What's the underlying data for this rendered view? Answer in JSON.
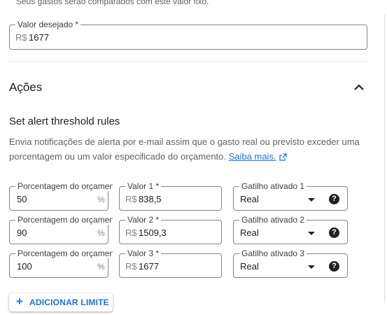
{
  "top_caption": "Seus gastos serão comparados com este valor fixo.",
  "desired_value": {
    "label": "Valor desejado *",
    "prefix": "R$",
    "value": "1677"
  },
  "actions_section": {
    "title": "Ações"
  },
  "rules": {
    "title": "Set alert threshold rules",
    "description": "Envia notificações de alerta por e-mail assim que o gasto real ou previsto exceder uma porcentagem ou um valor especificado do orçamento.",
    "learn_more": "Saiba mais."
  },
  "thresholds": [
    {
      "pct_label": "Porcentagem do orçamento",
      "pct_value": "50",
      "pct_suffix": "%",
      "val_label": "Valor 1 *",
      "val_prefix": "R$",
      "val_value": "838,5",
      "trig_label": "Gatilho ativado 1",
      "trig_value": "Real"
    },
    {
      "pct_label": "Porcentagem do orçamento",
      "pct_value": "90",
      "pct_suffix": "%",
      "val_label": "Valor 2 *",
      "val_prefix": "R$",
      "val_value": "1509,3",
      "trig_label": "Gatilho ativado 2",
      "trig_value": "Real"
    },
    {
      "pct_label": "Porcentagem do orçamento",
      "pct_value": "100",
      "pct_suffix": "%",
      "val_label": "Valor 3 *",
      "val_prefix": "R$",
      "val_value": "1677",
      "trig_label": "Gatilho ativado 3",
      "trig_value": "Real"
    }
  ],
  "add_button": {
    "label": "ADICIONAR LIMITE"
  },
  "colors": {
    "accent": "#1a73e8",
    "text": "#202124",
    "muted": "#5f6368",
    "border": "#80868b"
  }
}
